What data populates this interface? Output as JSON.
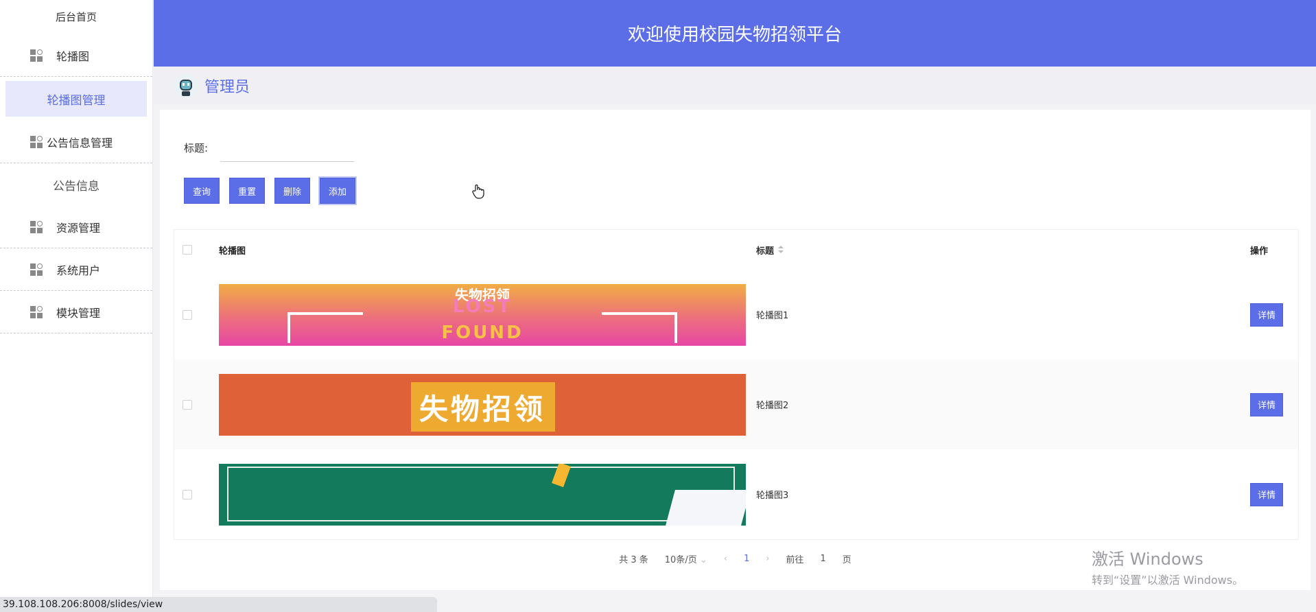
{
  "sidebar": {
    "home": "后台首页",
    "groups": [
      {
        "label": "轮播图",
        "subs": [
          {
            "label": "轮播图管理",
            "active": true
          }
        ]
      },
      {
        "label": "公告信息管理",
        "subs": [
          {
            "label": "公告信息",
            "active": false
          }
        ]
      },
      {
        "label": "资源管理",
        "subs": []
      },
      {
        "label": "系统用户",
        "subs": []
      },
      {
        "label": "模块管理",
        "subs": []
      }
    ]
  },
  "header": {
    "title": "欢迎使用校园失物招领平台"
  },
  "user": {
    "name": "管理员"
  },
  "search": {
    "label": "标题:",
    "value": ""
  },
  "actions": {
    "query": "查询",
    "reset": "重置",
    "delete": "删除",
    "add": "添加"
  },
  "table": {
    "headers": {
      "image": "轮播图",
      "title": "标题",
      "op": "操作"
    },
    "rows": [
      {
        "title": "轮播图1",
        "action": "详情",
        "banner": {
          "top": "失物招领",
          "mid": "LOST",
          "bot": "FOUND"
        }
      },
      {
        "title": "轮播图2",
        "action": "详情",
        "banner": {
          "text": "失物招领"
        }
      },
      {
        "title": "轮播图3",
        "action": "详情"
      }
    ]
  },
  "pagination": {
    "total": "共 3 条",
    "page_size": "10条/页",
    "current": "1",
    "goto_prefix": "前往",
    "goto_value": "1",
    "goto_suffix": "页"
  },
  "watermark": {
    "line1": "激活 Windows",
    "line2": "转到“设置”以激活 Windows。"
  },
  "status_url": "39.108.108.206:8008/slides/view",
  "colors": {
    "accent": "#5b6ee8",
    "active_bg": "#e7e8fb"
  }
}
